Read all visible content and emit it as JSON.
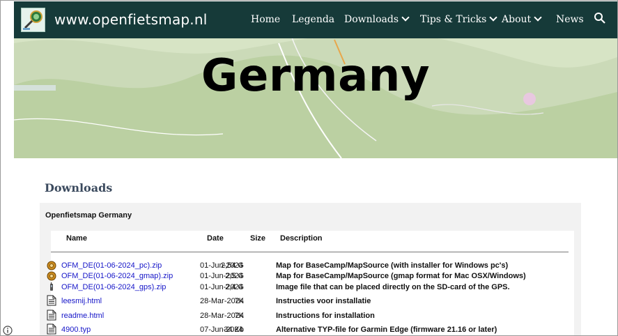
{
  "site": {
    "title": "www.openfietsmap.nl"
  },
  "nav": {
    "items": [
      {
        "label": "Home",
        "has_dropdown": false
      },
      {
        "label": "Legenda",
        "has_dropdown": false
      },
      {
        "label": "Downloads",
        "has_dropdown": true
      },
      {
        "label": "Tips & Tricks",
        "has_dropdown": true
      },
      {
        "label": "About",
        "has_dropdown": true
      },
      {
        "label": "News",
        "has_dropdown": false
      }
    ],
    "search_icon": "search-icon"
  },
  "hero": {
    "title": "Germany"
  },
  "downloads": {
    "heading": "Downloads",
    "panel_title": "Openfietsmap Germany",
    "columns": {
      "name": "Name",
      "date": "Date",
      "size": "Size",
      "description": "Description"
    },
    "rows": [
      {
        "icon": "zip-archive-icon",
        "name": "OFM_DE(01-06-2024_pc).zip",
        "date": "01-Jun-2024",
        "size": "2,54 G",
        "description": "Map for BaseCamp/MapSource (with installer for Windows pc's)"
      },
      {
        "icon": "zip-archive-icon",
        "name": "OFM_DE(01-06-2024_gmap).zip",
        "date": "01-Jun-2024",
        "size": "2,5 G",
        "description": "Map for BaseCamp/MapSource (gmap format for Mac OSX/Windows)"
      },
      {
        "icon": "gps-device-icon",
        "name": "OFM_DE(01-06-2024_gps).zip",
        "date": "01-Jun-2024",
        "size": "2,4 G",
        "description": "Image file that can be placed directly on the SD-card of the GPS."
      },
      {
        "icon": "document-icon",
        "name": "leesmij.html",
        "date": "28-Mar-2024",
        "size": "7K",
        "description": "Instructies voor installatie"
      },
      {
        "icon": "document-icon",
        "name": "readme.html",
        "date": "28-Mar-2024",
        "size": "7K",
        "description": "Instructions for installation"
      },
      {
        "icon": "document-icon",
        "name": "4900.typ",
        "date": "07-Jun-2024",
        "size": "34 Kb",
        "description": "Alternative TYP-file for Garmin Edge (firmware 21.16 or later)"
      }
    ]
  },
  "colors": {
    "nav_bg": "#163a39",
    "link": "#1515c8",
    "heading": "#3b4a5e",
    "panel_bg": "#f2f2f2"
  }
}
